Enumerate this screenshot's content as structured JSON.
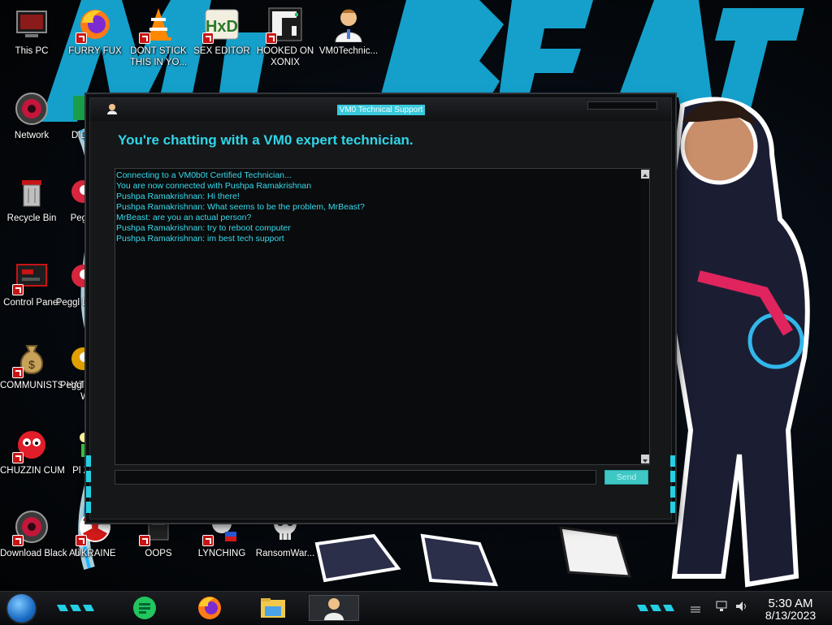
{
  "desktop": {
    "icons": [
      {
        "label": "This PC",
        "icon": "pc-icon"
      },
      {
        "label": "FURRY FUX",
        "icon": "firefox-icon"
      },
      {
        "label": "DONT STICK THIS IN YO...",
        "icon": "vlc-cone-icon"
      },
      {
        "label": "SEX EDITOR",
        "icon": "hxd-editor-icon"
      },
      {
        "label": "HOOKED ON XONIX",
        "icon": "xonix-game-icon"
      },
      {
        "label": "VM0Technic...",
        "icon": "doctor-icon"
      },
      {
        "label": "Network",
        "icon": "network-icon"
      },
      {
        "label": "Recycle Bin",
        "icon": "recycle-bin-icon"
      },
      {
        "label": "Control Panel",
        "icon": "control-panel-icon"
      },
      {
        "label": "COMMUNISTS HATE THIS G...",
        "icon": "money-bag-icon"
      },
      {
        "label": "CHUZZIN CUM",
        "icon": "chuzzle-icon"
      },
      {
        "label": "Download Black Ali...",
        "icon": "download-icon"
      },
      {
        "label": "UKRAINE",
        "icon": "radiation-icon"
      },
      {
        "label": "OOPS",
        "icon": "oops-icon"
      },
      {
        "label": "LYNCHING",
        "icon": "lynching-icon"
      },
      {
        "label": "RansomWar...",
        "icon": "skull-icon"
      },
      {
        "label": "D DU",
        "icon": "partial-icon"
      },
      {
        "label": "Peggl",
        "icon": "peggle-icon"
      },
      {
        "label": "Peggl De",
        "icon": "peggle-icon"
      },
      {
        "label": "Peggl of Wa",
        "icon": "peggle-icon"
      },
      {
        "label": "Pl Zo",
        "icon": "plants-icon"
      }
    ]
  },
  "chat_window": {
    "title": "VM0 Technical Support",
    "heading": "You're chatting with a VM0 expert technician.",
    "transcript": [
      "Connecting to a VM0b0t Certified Technician...",
      "You are now connected with Pushpa Ramakrishnan",
      "Pushpa Ramakrishnan: Hi there!",
      "Pushpa Ramakrishnan: What seems to be the problem, MrBeast?",
      "MrBeast: are you an actual person?",
      "Pushpa Ramakrishnan: try to reboot computer",
      "Pushpa Ramakrishnan: im best tech support"
    ],
    "input_value": "",
    "send_label": "Send"
  },
  "taskbar": {
    "apps": [
      {
        "name": "messaging-app-icon",
        "color": "#22c55e"
      },
      {
        "name": "firefox-icon",
        "color": "#ff7a18"
      },
      {
        "name": "file-explorer-icon",
        "color": "#f2c94c"
      },
      {
        "name": "vm0-support-icon",
        "color": "#d9dde2"
      }
    ],
    "time": "5:30 AM",
    "date": "8/13/2023"
  },
  "colors": {
    "accent": "#2fd6e8",
    "text_cyan": "#37dbee",
    "send_button": "#3ec7c5"
  }
}
